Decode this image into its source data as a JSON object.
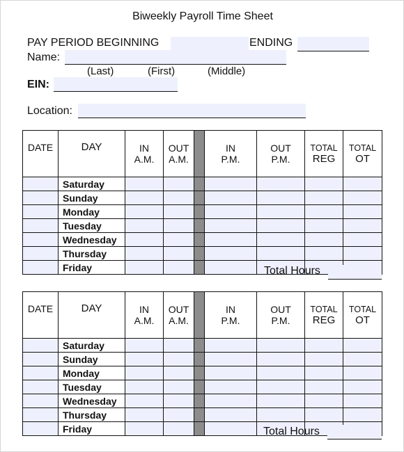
{
  "title": "Biweekly Payroll Time Sheet",
  "header": {
    "pay_period_label": "PAY PERIOD BEGINNING",
    "pay_period_begin_value": "",
    "ending_label": "ENDING",
    "ending_value": "",
    "name_label": "Name:",
    "name_value": "",
    "name_parts": [
      "(Last)",
      "(First)",
      "(Middle)"
    ],
    "ein_label": "EIN:",
    "ein_value": "",
    "location_label": "Location:",
    "location_value": ""
  },
  "columns": {
    "date": "DATE",
    "day": "DAY",
    "in_am": [
      "IN",
      "A.M."
    ],
    "out_am": [
      "OUT",
      "A.M."
    ],
    "in_pm": [
      "IN",
      "P.M."
    ],
    "out_pm": [
      "OUT",
      "P.M."
    ],
    "total_reg": [
      "TOTAL",
      "REG"
    ],
    "total_ot": [
      "TOTAL",
      "OT"
    ]
  },
  "weeks": [
    {
      "days": [
        "Saturday",
        "Sunday",
        "Monday",
        "Tuesday",
        "Wednesday",
        "Thursday",
        "Friday"
      ],
      "total_hours_label": "Total Hours",
      "total_hours_value": ""
    },
    {
      "days": [
        "Saturday",
        "Sunday",
        "Monday",
        "Tuesday",
        "Wednesday",
        "Thursday",
        "Friday"
      ],
      "total_hours_label": "Total Hours",
      "total_hours_value": ""
    }
  ],
  "colors": {
    "field_fill": "#eef1fd",
    "separator_gray": "#8c8c8c"
  }
}
